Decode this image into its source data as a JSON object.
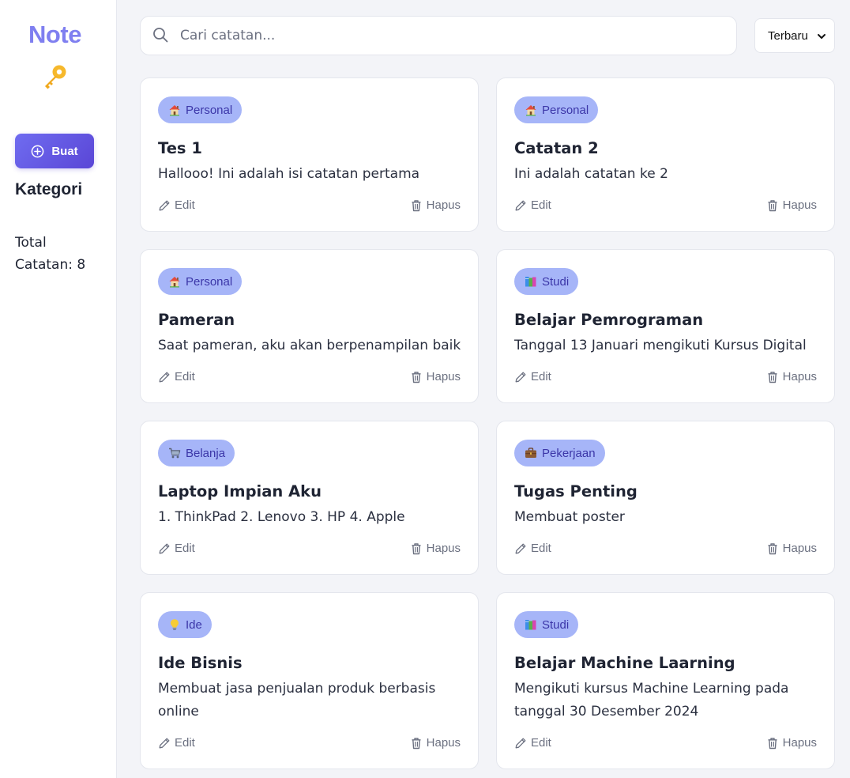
{
  "app": {
    "logo_text": "Note",
    "logo_icon": "key-icon"
  },
  "sidebar": {
    "create_label": "Buat",
    "category_heading": "Kategori",
    "total_label": "Total Catatan: 8"
  },
  "search": {
    "placeholder": "Cari catatan...",
    "value": ""
  },
  "sort": {
    "selected": "Terbaru"
  },
  "colors": {
    "accent": "#7f7ff0",
    "button": "#5a46d6",
    "badge_bg": "#a6b5f8",
    "badge_text": "#3b36a8"
  },
  "notes": [
    {
      "category": "Personal",
      "icon": "house-icon",
      "title": "Tes 1",
      "body": "Hallooo! Ini adalah isi catatan pertama",
      "edit": "Edit",
      "delete": "Hapus"
    },
    {
      "category": "Personal",
      "icon": "house-icon",
      "title": "Catatan 2",
      "body": "Ini adalah catatan ke 2",
      "edit": "Edit",
      "delete": "Hapus"
    },
    {
      "category": "Personal",
      "icon": "house-icon",
      "title": "Pameran",
      "body": "Saat pameran, aku akan berpenampilan baik",
      "edit": "Edit",
      "delete": "Hapus"
    },
    {
      "category": "Studi",
      "icon": "books-icon",
      "title": "Belajar Pemrograman",
      "body": "Tanggal 13 Januari mengikuti Kursus Digital",
      "edit": "Edit",
      "delete": "Hapus"
    },
    {
      "category": "Belanja",
      "icon": "cart-icon",
      "title": "Laptop Impian Aku",
      "body": "1. ThinkPad 2. Lenovo 3. HP 4. Apple",
      "edit": "Edit",
      "delete": "Hapus"
    },
    {
      "category": "Pekerjaan",
      "icon": "briefcase-icon",
      "title": "Tugas Penting",
      "body": "Membuat poster",
      "edit": "Edit",
      "delete": "Hapus"
    },
    {
      "category": "Ide",
      "icon": "lightbulb-icon",
      "title": "Ide Bisnis",
      "body": "Membuat jasa penjualan produk berbasis online",
      "edit": "Edit",
      "delete": "Hapus"
    },
    {
      "category": "Studi",
      "icon": "books-icon",
      "title": "Belajar Machine Laarning",
      "body": "Mengikuti kursus Machine Learning pada tanggal 30 Desember 2024",
      "edit": "Edit",
      "delete": "Hapus"
    }
  ]
}
